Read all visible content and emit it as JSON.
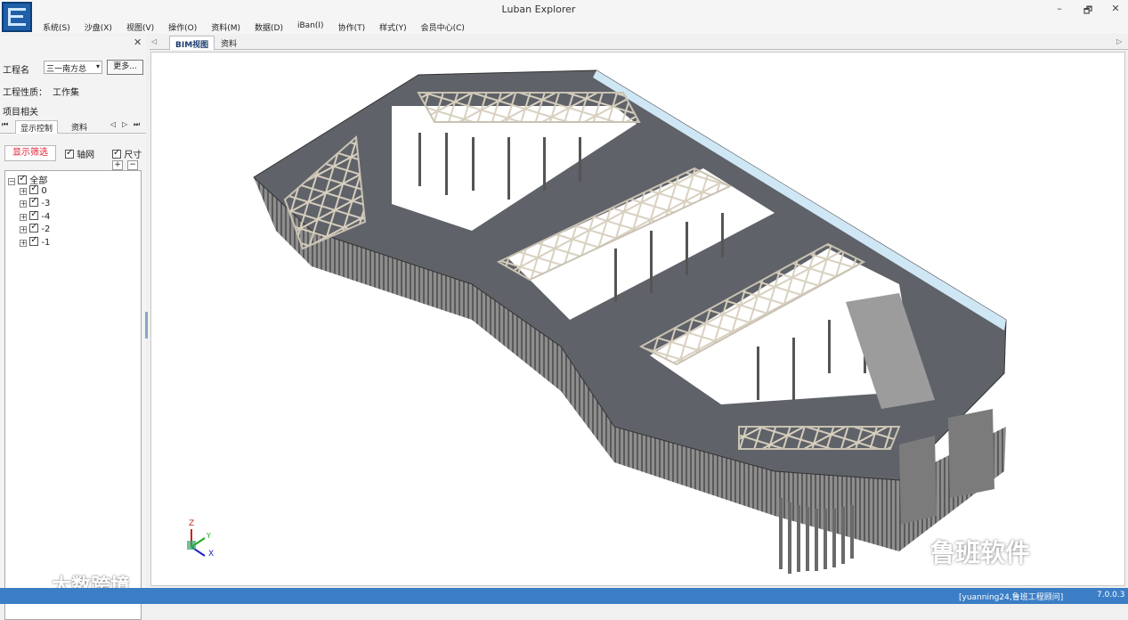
{
  "window": {
    "title": "Luban Explorer",
    "controls": [
      "–",
      "🗗",
      "✕"
    ]
  },
  "menu": [
    "系统(S)",
    "沙盘(X)",
    "视图(V)",
    "操作(O)",
    "资料(M)",
    "数据(D)",
    "iBan(I)",
    "协作(T)",
    "样式(Y)",
    "会员中心(C)"
  ],
  "left_panel": {
    "project_label": "工程名",
    "project_value": "三一南方总",
    "more_button": "更多...",
    "property_label": "工程性质：",
    "property_value": "工作集",
    "section_label": "项目相关",
    "subtabs": [
      "显示控制",
      "资料"
    ],
    "filter_button": "显示筛选",
    "axis_checkbox": "轴网",
    "dimension_checkbox": "尺寸",
    "tree": [
      {
        "label": "全部"
      },
      {
        "label": "0"
      },
      {
        "label": "-3"
      },
      {
        "label": "-4"
      },
      {
        "label": "-2"
      },
      {
        "label": "-1"
      }
    ]
  },
  "doc_tabs": [
    "BIM视图",
    "资料"
  ],
  "axes": {
    "z": "Z",
    "y": "Y",
    "x": "X"
  },
  "watermarks": {
    "left": "大数跨境",
    "right": "鲁班软件"
  },
  "status": {
    "user": "[yuanning24,鲁班工程顾问]",
    "version": "7.0.0.3"
  },
  "colors": {
    "statusbar": "#3b7ec6",
    "filter_text": "#dd2233",
    "active_tab_text": "#1b3c6e"
  }
}
